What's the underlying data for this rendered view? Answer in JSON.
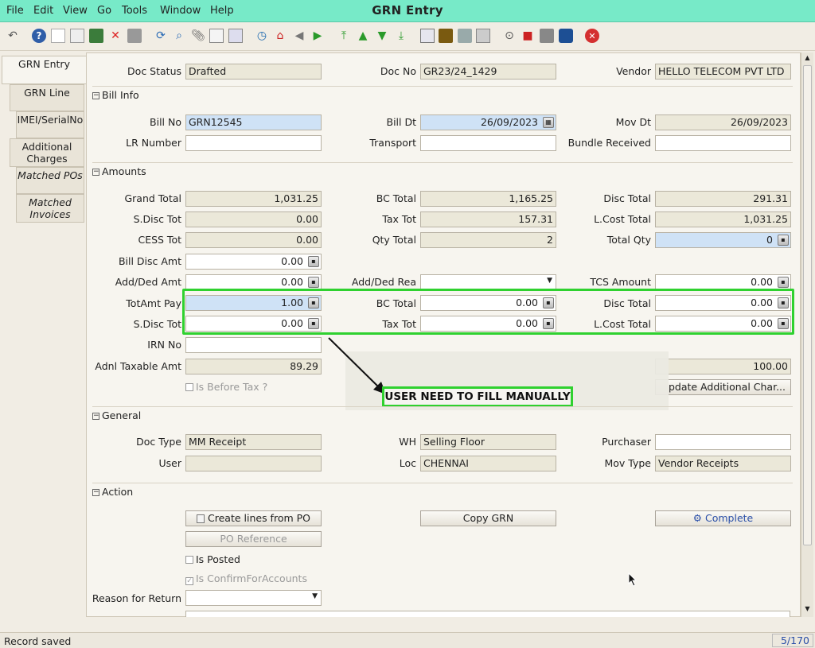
{
  "window": {
    "title": "GRN Entry"
  },
  "menu": [
    "File",
    "Edit",
    "View",
    "Go",
    "Tools",
    "Window",
    "Help"
  ],
  "toolbar_icons": [
    "undo-icon",
    "help-icon",
    "new-icon",
    "copy-icon",
    "save-icon",
    "delete-icon",
    "print-preview-icon",
    "refresh-icon",
    "find-icon",
    "attach-icon",
    "chat-icon",
    "grid-toggle-icon",
    "history-icon",
    "home-icon",
    "previous-icon",
    "next-icon",
    "first-record-icon",
    "parent-icon",
    "detail-icon",
    "last-record-icon",
    "report-icon",
    "archive-icon",
    "print-icon",
    "zoom-icon",
    "workflow-icon",
    "product-icon",
    "request-icon",
    "close-icon"
  ],
  "tabs": [
    "GRN Entry",
    "GRN Line",
    "IMEI/SerialNo",
    "Additional Charges",
    "Matched POs",
    "Matched Invoices"
  ],
  "header": {
    "doc_status_label": "Doc Status",
    "doc_status": "Drafted",
    "doc_no_label": "Doc No",
    "doc_no": "GR23/24_1429",
    "vendor_label": "Vendor",
    "vendor": "HELLO TELECOM PVT LTD"
  },
  "bill_info": {
    "title": "Bill Info",
    "bill_no_label": "Bill No",
    "bill_no": "GRN12545",
    "bill_dt_label": "Bill Dt",
    "bill_dt": "26/09/2023",
    "mov_dt_label": "Mov Dt",
    "mov_dt": "26/09/2023",
    "lr_label": "LR Number",
    "lr": "",
    "transport_label": "Transport",
    "transport": "",
    "bundle_label": "Bundle Received",
    "bundle": ""
  },
  "amounts": {
    "title": "Amounts",
    "grand_total_label": "Grand Total",
    "grand_total": "1,031.25",
    "bc_total_label": "BC Total",
    "bc_total": "1,165.25",
    "disc_total_label": "Disc Total",
    "disc_total": "291.31",
    "sdisc_tot_label": "S.Disc Tot",
    "sdisc_tot": "0.00",
    "tax_tot_label": "Tax Tot",
    "tax_tot": "157.31",
    "lcost_total_label": "L.Cost Total",
    "lcost_total": "1,031.25",
    "cess_label": "CESS Tot",
    "cess": "0.00",
    "qty_total_label": "Qty Total",
    "qty_total": "2",
    "total_qty_label": "Total Qty",
    "total_qty": "0",
    "bill_disc_label": "Bill Disc Amt",
    "bill_disc": "0.00",
    "add_ded_label": "Add/Ded Amt",
    "add_ded": "0.00",
    "add_ded_rea_label": "Add/Ded Rea",
    "add_ded_rea": "",
    "tcs_label": "TCS Amount",
    "tcs": "0.00",
    "totamt_pay_label": "TotAmt Pay",
    "totamt_pay": "1.00",
    "bc_total2_label": "BC Total",
    "bc_total2": "0.00",
    "disc_total2_label": "Disc Total",
    "disc_total2": "0.00",
    "sdisc_tot2_label": "S.Disc Tot",
    "sdisc_tot2": "0.00",
    "tax_tot2_label": "Tax Tot",
    "tax_tot2": "0.00",
    "lcost_total2_label": "L.Cost Total",
    "lcost_total2": "0.00",
    "irn_label": "IRN No",
    "irn": "",
    "adnl_label": "Adnl Taxable Amt",
    "adnl": "89.29",
    "right_value": "100.00",
    "is_before_tax_label": "Is Before Tax ?",
    "update_btn": "pdate Additional Char..."
  },
  "annotation": {
    "text": "USER NEED TO FILL MANUALLY"
  },
  "general": {
    "title": "General",
    "doc_type_label": "Doc Type",
    "doc_type": "MM Receipt",
    "wh_label": "WH",
    "wh": "Selling Floor",
    "purchaser_label": "Purchaser",
    "purchaser": "",
    "user_label": "User",
    "user": "",
    "loc_label": "Loc",
    "loc": "CHENNAI",
    "mov_type_label": "Mov Type",
    "mov_type": "Vendor Receipts"
  },
  "action": {
    "title": "Action",
    "create_lines_btn": "Create lines from PO",
    "copy_grn_btn": "Copy GRN",
    "complete_btn": "Complete",
    "po_reference_btn": "PO Reference",
    "is_posted_label": "Is Posted",
    "is_confirm_label": "Is ConfirmForAccounts",
    "reason_label": "Reason for Return",
    "reason": ""
  },
  "status": {
    "message": "Record saved",
    "record_count": "5/170"
  }
}
